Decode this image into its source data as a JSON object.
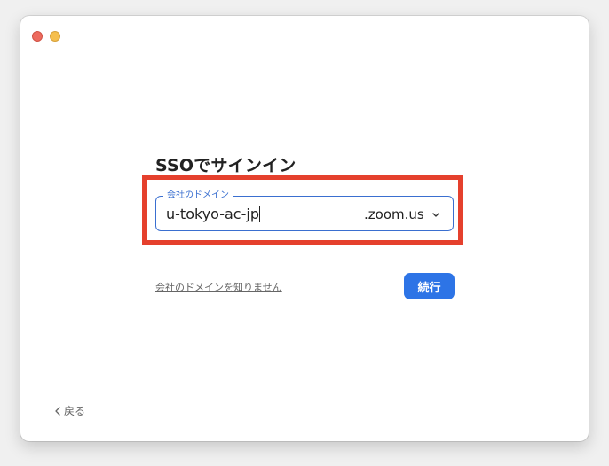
{
  "window": {
    "title": "SSOでサインイン"
  },
  "domain_field": {
    "label": "会社のドメイン",
    "value": "u-tokyo-ac-jp",
    "suffix": ".zoom.us",
    "dropdown_icon": "chevron-down-icon"
  },
  "links": {
    "unknown_domain": "会社のドメインを知りません"
  },
  "buttons": {
    "continue": "続行",
    "back": "戻る",
    "back_icon": "chevron-left-icon"
  },
  "colors": {
    "accent": "#2d74e6",
    "highlight": "#e5402d",
    "field_border": "#3a6fd0"
  }
}
